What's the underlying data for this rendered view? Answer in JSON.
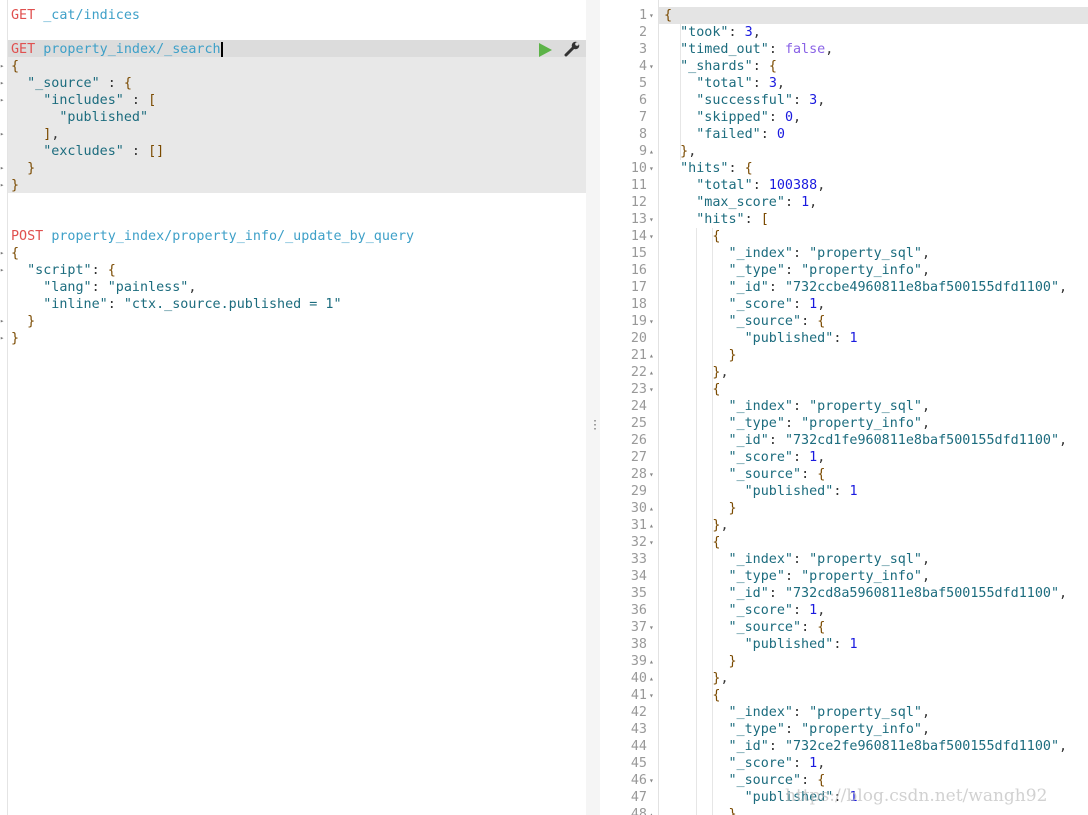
{
  "colors": {
    "method": "#e0504f",
    "url": "#3ea0c8",
    "run": "#5cb348"
  },
  "request_editor": {
    "requests": [
      {
        "method": "GET",
        "url": "_cat/indices",
        "body": []
      },
      {
        "method": "GET",
        "url": "property_index/_search",
        "selected": true,
        "body": [
          "{",
          "  \"_source\" : {",
          "    \"includes\" : [",
          "      \"published\"",
          "    ],",
          "    \"excludes\" : []",
          "  }",
          "}"
        ]
      },
      {
        "method": "POST",
        "url": "property_index/property_info/_update_by_query",
        "body": [
          "{",
          "  \"script\": {",
          "    \"lang\": \"painless\",",
          "    \"inline\": \"ctx._source.published = 1\"",
          "  }",
          "}"
        ]
      }
    ],
    "icons": {
      "run": "play-icon",
      "settings": "wrench-icon"
    }
  },
  "response": {
    "lines": [
      "{",
      "  \"took\": 3,",
      "  \"timed_out\": false,",
      "  \"_shards\": {",
      "    \"total\": 3,",
      "    \"successful\": 3,",
      "    \"skipped\": 0,",
      "    \"failed\": 0",
      "  },",
      "  \"hits\": {",
      "    \"total\": 100388,",
      "    \"max_score\": 1,",
      "    \"hits\": [",
      "      {",
      "        \"_index\": \"property_sql\",",
      "        \"_type\": \"property_info\",",
      "        \"_id\": \"732ccbe4960811e8baf500155dfd1100\",",
      "        \"_score\": 1,",
      "        \"_source\": {",
      "          \"published\": 1",
      "        }",
      "      },",
      "      {",
      "        \"_index\": \"property_sql\",",
      "        \"_type\": \"property_info\",",
      "        \"_id\": \"732cd1fe960811e8baf500155dfd1100\",",
      "        \"_score\": 1,",
      "        \"_source\": {",
      "          \"published\": 1",
      "        }",
      "      },",
      "      {",
      "        \"_index\": \"property_sql\",",
      "        \"_type\": \"property_info\",",
      "        \"_id\": \"732cd8a5960811e8baf500155dfd1100\",",
      "        \"_score\": 1,",
      "        \"_source\": {",
      "          \"published\": 1",
      "        }",
      "      },",
      "      {",
      "        \"_index\": \"property_sql\",",
      "        \"_type\": \"property_info\",",
      "        \"_id\": \"732ce2fe960811e8baf500155dfd1100\",",
      "        \"_score\": 1,",
      "        \"_source\": {",
      "          \"published\": 1",
      "        }"
    ],
    "fold_open": [
      1,
      4,
      10,
      13,
      14,
      19,
      23,
      28,
      32,
      37,
      41,
      46
    ],
    "fold_close": [
      9,
      21,
      22,
      30,
      31,
      39,
      40,
      48
    ]
  },
  "watermark": "https://blog.csdn.net/wangh92"
}
